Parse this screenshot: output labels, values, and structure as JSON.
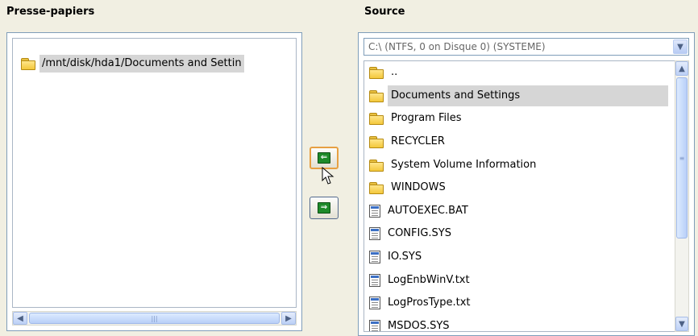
{
  "clipboard": {
    "title": "Presse-papiers",
    "items": [
      {
        "label": "/mnt/disk/hda1/Documents and Settin",
        "icon": "folder-icon"
      }
    ]
  },
  "source": {
    "title": "Source",
    "drive": "C:\\ (NTFS, 0 on Disque 0) (SYSTEME)",
    "items": [
      {
        "label": "..",
        "icon": "folder-icon"
      },
      {
        "label": "Documents and Settings",
        "icon": "folder-icon",
        "selected": true
      },
      {
        "label": "Program Files",
        "icon": "folder-icon"
      },
      {
        "label": "RECYCLER",
        "icon": "folder-icon"
      },
      {
        "label": "System Volume Information",
        "icon": "folder-icon"
      },
      {
        "label": "WINDOWS",
        "icon": "folder-icon"
      },
      {
        "label": "AUTOEXEC.BAT",
        "icon": "file-icon"
      },
      {
        "label": "CONFIG.SYS",
        "icon": "file-icon"
      },
      {
        "label": "IO.SYS",
        "icon": "file-icon"
      },
      {
        "label": "LogEnbWinV.txt",
        "icon": "file-icon"
      },
      {
        "label": "LogProsType.txt",
        "icon": "file-icon"
      },
      {
        "label": "MSDOS.SYS",
        "icon": "file-icon"
      }
    ]
  },
  "colors": {
    "background": "#f1efe2",
    "selection": "#d6d6d6",
    "arrow_green": "#1d8a2a",
    "focus_orange": "#e7a043"
  }
}
